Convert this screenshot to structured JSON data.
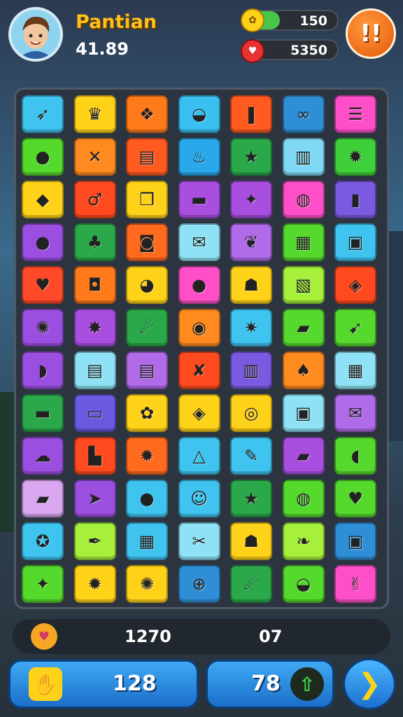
{
  "player": {
    "name": "Pantian",
    "score": "41.89",
    "avatar_icon": "avatar-face"
  },
  "resources": [
    {
      "name": "coins",
      "value": "150",
      "icon": "coin-icon",
      "fill": 0.25,
      "color": "#47c74a"
    },
    {
      "name": "hearts",
      "value": "5350",
      "icon": "heart-balloon-icon"
    }
  ],
  "alert_button": {
    "label": "!!",
    "icon": "alert-icon"
  },
  "colors": {
    "accent": "#ffbf1a",
    "board_bg": "#2c3440",
    "alert": "#e4570a",
    "button_blue": "#1b6fc9"
  },
  "board": {
    "rows": 12,
    "cols": 7,
    "tiles": [
      [
        {
          "c": "#3fc4f0",
          "g": "➶"
        },
        {
          "c": "#ffd21a",
          "g": "♛"
        },
        {
          "c": "#ff7a1a",
          "g": "❖"
        },
        {
          "c": "#39c0f0",
          "g": "◒"
        },
        {
          "c": "#ff5a1f",
          "g": "❚"
        },
        {
          "c": "#2f8fd6",
          "g": "∞"
        },
        {
          "c": "#ff4fc8",
          "g": "☰"
        }
      ],
      [
        {
          "c": "#56d92d",
          "g": "●"
        },
        {
          "c": "#ff8a1f",
          "g": "✕"
        },
        {
          "c": "#ff5a1f",
          "g": "▤"
        },
        {
          "c": "#29a9ea",
          "g": "♨"
        },
        {
          "c": "#2aa84a",
          "g": "★"
        },
        {
          "c": "#7fd9f5",
          "g": "▥"
        },
        {
          "c": "#3fcf3a",
          "g": "✹"
        }
      ],
      [
        {
          "c": "#ffd21a",
          "g": "◆"
        },
        {
          "c": "#ff4a1f",
          "g": "♂"
        },
        {
          "c": "#ffd21a",
          "g": "❒"
        },
        {
          "c": "#a84fe0",
          "g": "▬"
        },
        {
          "c": "#a84fe0",
          "g": "✦"
        },
        {
          "c": "#ff4fc8",
          "g": "◍"
        },
        {
          "c": "#7a5ae0",
          "g": "▮"
        }
      ],
      [
        {
          "c": "#9b4fe0",
          "g": "●"
        },
        {
          "c": "#2aa84a",
          "g": "♣"
        },
        {
          "c": "#ff6a1f",
          "g": "◙"
        },
        {
          "c": "#8fe2f5",
          "g": "✉"
        },
        {
          "c": "#b06be8",
          "g": "❦"
        },
        {
          "c": "#56d92d",
          "g": "▦"
        },
        {
          "c": "#3fc4f0",
          "g": "▣"
        }
      ],
      [
        {
          "c": "#ff4a2a",
          "g": "♥"
        },
        {
          "c": "#ff7a1a",
          "g": "◘"
        },
        {
          "c": "#ffd21a",
          "g": "◕"
        },
        {
          "c": "#ff4fc8",
          "g": "●"
        },
        {
          "c": "#ffd21a",
          "g": "☗"
        },
        {
          "c": "#a6ef3a",
          "g": "▧"
        },
        {
          "c": "#ff4a1f",
          "g": "◈"
        }
      ],
      [
        {
          "c": "#9b4fe0",
          "g": "✺"
        },
        {
          "c": "#a84fe0",
          "g": "✸"
        },
        {
          "c": "#2aa84a",
          "g": "☄"
        },
        {
          "c": "#ff8a1f",
          "g": "◉"
        },
        {
          "c": "#3fc4f0",
          "g": "✷"
        },
        {
          "c": "#56d92d",
          "g": "▰"
        },
        {
          "c": "#56d92d",
          "g": "➹"
        }
      ],
      [
        {
          "c": "#9b4fe0",
          "g": "◗"
        },
        {
          "c": "#8fe2f5",
          "g": "▤"
        },
        {
          "c": "#b06be8",
          "g": "▤"
        },
        {
          "c": "#ff4a1f",
          "g": "✘"
        },
        {
          "c": "#7a5ae0",
          "g": "▥"
        },
        {
          "c": "#ff8a1f",
          "g": "♠"
        },
        {
          "c": "#8fe2f5",
          "g": "▦"
        }
      ],
      [
        {
          "c": "#2aa84a",
          "g": "▬"
        },
        {
          "c": "#6a5ae0",
          "g": "▭"
        },
        {
          "c": "#ffd21a",
          "g": "✿"
        },
        {
          "c": "#ffd21a",
          "g": "◈"
        },
        {
          "c": "#ffd21a",
          "g": "◎"
        },
        {
          "c": "#8fe2f5",
          "g": "▣"
        },
        {
          "c": "#b06be8",
          "g": "✉"
        }
      ],
      [
        {
          "c": "#9b4fe0",
          "g": "☁"
        },
        {
          "c": "#ff4a1f",
          "g": "▙"
        },
        {
          "c": "#ff6a1f",
          "g": "✹"
        },
        {
          "c": "#3fc4f0",
          "g": "△"
        },
        {
          "c": "#3fc4f0",
          "g": "✎"
        },
        {
          "c": "#a84fe0",
          "g": "▰"
        },
        {
          "c": "#56d92d",
          "g": "◖"
        }
      ],
      [
        {
          "c": "#d9a6f0",
          "g": "▰"
        },
        {
          "c": "#9b4fe0",
          "g": "➤"
        },
        {
          "c": "#3fc4f0",
          "g": "●"
        },
        {
          "c": "#3fc4f0",
          "g": "☺"
        },
        {
          "c": "#2aa84a",
          "g": "★"
        },
        {
          "c": "#56d92d",
          "g": "◍"
        },
        {
          "c": "#56d92d",
          "g": "♥"
        }
      ],
      [
        {
          "c": "#3fc4f0",
          "g": "✪"
        },
        {
          "c": "#a6ef3a",
          "g": "✒"
        },
        {
          "c": "#3fc4f0",
          "g": "▦"
        },
        {
          "c": "#8fe2f5",
          "g": "✂"
        },
        {
          "c": "#ffd21a",
          "g": "☗"
        },
        {
          "c": "#a6ef3a",
          "g": "❧"
        },
        {
          "c": "#2f8fd6",
          "g": "▣"
        }
      ],
      [
        {
          "c": "#56d92d",
          "g": "✦"
        },
        {
          "c": "#ffd21a",
          "g": "✹"
        },
        {
          "c": "#ffd21a",
          "g": "✺"
        },
        {
          "c": "#2f8fd6",
          "g": "⊕"
        },
        {
          "c": "#2aa84a",
          "g": "☄"
        },
        {
          "c": "#56d92d",
          "g": "◒"
        },
        {
          "c": "#ff4fc8",
          "g": "✌"
        }
      ]
    ]
  },
  "stats": {
    "icon": "cake-icon",
    "value_a": "1270",
    "value_b": "07"
  },
  "bottom": {
    "left_value": "128",
    "left_icon": "hand-up-icon",
    "mid_value": "78",
    "mid_icon": "green-arrow-icon",
    "next_icon": "chevron-right-icon"
  }
}
